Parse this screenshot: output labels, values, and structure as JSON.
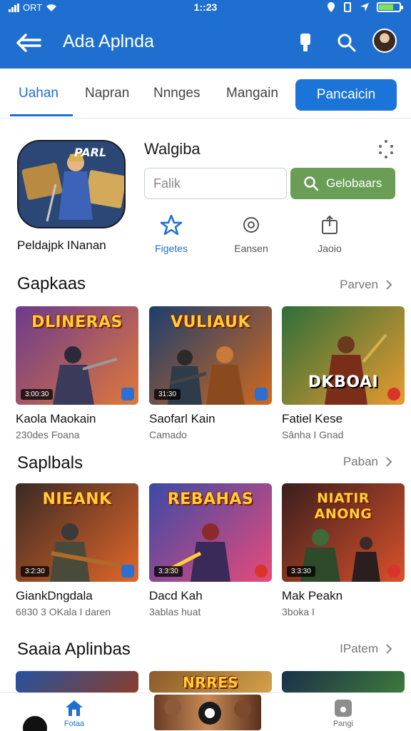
{
  "status_bar": {
    "carrier": "ORT",
    "time": "1::23",
    "battery_level": 0.7
  },
  "app_bar": {
    "title": "Ada Aplnda",
    "icons": [
      "back-arrow-icon",
      "bottle-icon",
      "search-icon",
      "avatar"
    ]
  },
  "tabs": {
    "items": [
      {
        "label": "Uahan",
        "active": true
      },
      {
        "label": "Napran",
        "active": false
      },
      {
        "label": "Nnnges",
        "active": false
      },
      {
        "label": "Mangain",
        "active": false
      }
    ],
    "button_label": "Pancaicin"
  },
  "featured": {
    "caption": "Peldajpk INanan",
    "title": "Walgiba",
    "image_title": "PARL",
    "input_placeholder": "Falik",
    "search_button_label": "Gelobaars",
    "actions": [
      {
        "label": "Figetes",
        "icon": "star-outline-icon",
        "active": true
      },
      {
        "label": "Eansen",
        "icon": "circle-icon",
        "active": false
      },
      {
        "label": "Jaoio",
        "icon": "share-icon",
        "active": false
      }
    ]
  },
  "sections": [
    {
      "title": "Gapkaas",
      "see_all": "Parven",
      "cards": [
        {
          "image_title": "DLINERAS",
          "duration": "3:00:30",
          "corner": "blue",
          "name": "Kaola Maokain",
          "sub": "230des Foana",
          "colors": [
            "#6c3a8e",
            "#e0783a"
          ]
        },
        {
          "image_title": "VULIAUK",
          "duration": "31:30",
          "corner": "blue",
          "name": "Saofarl Kain",
          "sub": "Camado",
          "colors": [
            "#1c3e6e",
            "#d2691e"
          ]
        },
        {
          "image_title": "DKBOAI",
          "duration": "",
          "corner": "red",
          "name": "Fatiel Kese",
          "sub": "Sânha I Gnad",
          "colors": [
            "#2e6f3a",
            "#e89a30"
          ]
        }
      ]
    },
    {
      "title": "Saplbals",
      "see_all": "Paban",
      "cards": [
        {
          "image_title": "NIEANK",
          "duration": "3:2:30",
          "corner": "blue",
          "name": "GiankDngdala",
          "sub": "6830 3 OKala I daren",
          "colors": [
            "#3a2a24",
            "#e2662a"
          ]
        },
        {
          "image_title": "REBAHAS",
          "duration": "3:3:30",
          "corner": "red",
          "name": "Dacd Kah",
          "sub": "3ablas huat",
          "colors": [
            "#3b4aa6",
            "#e84a7a"
          ]
        },
        {
          "image_title": "NIATIR ANONG",
          "duration": "3:3:30",
          "corner": "red",
          "name": "Mak Peakn",
          "sub": "3boka I",
          "colors": [
            "#3a1e1e",
            "#d8512a"
          ]
        }
      ]
    },
    {
      "title": "Saaia Aplinbas",
      "see_all": "IPatem",
      "cards": [
        {
          "image_title": "",
          "colors": [
            "#2452a0",
            "#8a3e2a"
          ]
        },
        {
          "image_title": "NRRES",
          "colors": [
            "#8a5a2a",
            "#d4a24a"
          ]
        },
        {
          "image_title": "",
          "colors": [
            "#1a2f4a",
            "#3d7a3a"
          ]
        }
      ]
    }
  ],
  "bottom_nav": {
    "home_label": "Fotaa",
    "right_label": "Pangi"
  }
}
